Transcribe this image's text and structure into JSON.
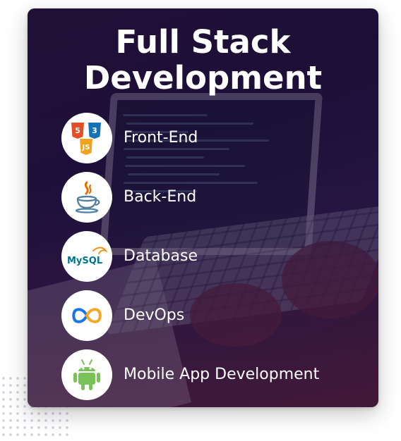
{
  "title": {
    "line1": "Full Stack",
    "line2": "Development"
  },
  "items": [
    {
      "label": "Front-End",
      "icon": "html5-css3-js-icon"
    },
    {
      "label": "Back-End",
      "icon": "java-icon"
    },
    {
      "label": "Database",
      "icon": "mysql-icon",
      "icon_text": "MySQL"
    },
    {
      "label": "DevOps",
      "icon": "devops-infinity-icon"
    },
    {
      "label": "Mobile App Development",
      "icon": "android-icon"
    }
  ],
  "colors": {
    "html5": "#e34f26",
    "css3": "#1572b6",
    "js": "#f0a31c",
    "java_red": "#e76f00",
    "java_blue": "#5382a1",
    "mysql_blue": "#00758f",
    "mysql_orange": "#f29111",
    "devops_blue": "#1a73e8",
    "devops_orange": "#f5a623",
    "android": "#78c257"
  }
}
